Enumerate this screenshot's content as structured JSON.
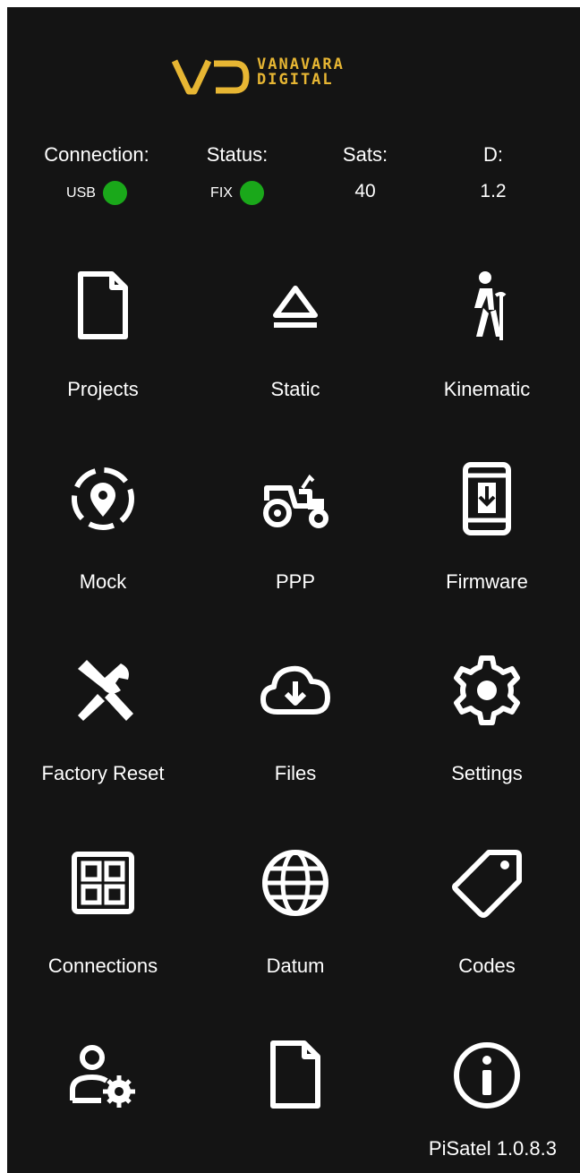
{
  "logo": {
    "line1": "VANAVARA",
    "line2": "DIGITAL",
    "accent": "#e7b633"
  },
  "status": {
    "connection": {
      "label": "Connection:",
      "value": "USB",
      "indicator": "#1aa81a"
    },
    "state": {
      "label": "Status:",
      "value": "FIX",
      "indicator": "#1aa81a"
    },
    "sats": {
      "label": "Sats:",
      "value": "40"
    },
    "d": {
      "label": "D:",
      "value": "1.2"
    }
  },
  "menu": [
    {
      "label": "Projects",
      "icon": "document-icon"
    },
    {
      "label": "Static",
      "icon": "eject-icon"
    },
    {
      "label": "Kinematic",
      "icon": "walking-person-icon"
    },
    {
      "label": "Mock",
      "icon": "location-target-icon"
    },
    {
      "label": "PPP",
      "icon": "tractor-icon"
    },
    {
      "label": "Firmware",
      "icon": "phone-download-icon"
    },
    {
      "label": "Factory Reset",
      "icon": "tools-icon"
    },
    {
      "label": "Files",
      "icon": "cloud-download-icon"
    },
    {
      "label": "Settings",
      "icon": "gear-icon"
    },
    {
      "label": "Connections",
      "icon": "grid-icon"
    },
    {
      "label": "Datum",
      "icon": "globe-icon"
    },
    {
      "label": "Codes",
      "icon": "tag-icon"
    },
    {
      "label": "",
      "icon": "user-settings-icon"
    },
    {
      "label": "",
      "icon": "document-icon"
    },
    {
      "label": "",
      "icon": "info-icon"
    }
  ],
  "version": "PiSatel 1.0.8.3"
}
